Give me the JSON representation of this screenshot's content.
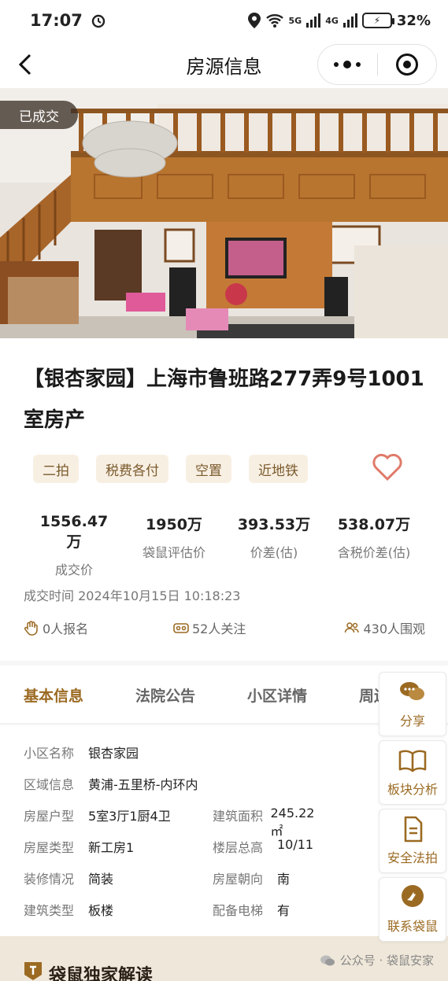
{
  "status": {
    "time": "17:07",
    "network": "5G",
    "network2": "4G",
    "battery": "32%"
  },
  "nav": {
    "title": "房源信息"
  },
  "photo": {
    "badge": "已成交"
  },
  "house": {
    "title": "【银杏家园】上海市鲁班路277弄9号1001室房产",
    "tags": [
      "二拍",
      "税费各付",
      "空置",
      "近地铁"
    ]
  },
  "stats": [
    {
      "value": "1556.47万",
      "label": "成交价"
    },
    {
      "value": "1950万",
      "label": "袋鼠评估价"
    },
    {
      "value": "393.53万",
      "label": "价差(估)"
    },
    {
      "value": "538.07万",
      "label": "含税价差(估)"
    }
  ],
  "deal": {
    "time_text": "成交时间 2024年10月15日 10:18:23"
  },
  "counts": {
    "signup": "0人报名",
    "follow": "52人关注",
    "views": "430人围观"
  },
  "tabs": [
    "基本信息",
    "法院公告",
    "小区详情",
    "周边"
  ],
  "basic": {
    "community_label": "小区名称",
    "community": "银杏家园",
    "area_label": "区域信息",
    "area": "黄浦-五里桥-内环内",
    "layout_label": "房屋户型",
    "layout": "5室3厅1厨4卫",
    "size_label": "建筑面积",
    "size": "245.22㎡",
    "type_label": "房屋类型",
    "type": "新工房1",
    "floors_label": "楼层总高",
    "floors": "10/11",
    "decor_label": "装修情况",
    "decor": "简装",
    "facing_label": "房屋朝向",
    "facing": "南",
    "build_label": "建筑类型",
    "build": "板楼",
    "elevator_label": "配备电梯",
    "elevator": "有"
  },
  "exclusive": {
    "title": "袋鼠独家解读",
    "watermark": "公众号 · 袋鼠安家"
  },
  "float": {
    "share": "分享",
    "analysis": "板块分析",
    "legal": "安全法拍",
    "contact": "联系袋鼠"
  },
  "colors": {
    "accent": "#9b6a22",
    "tag_bg": "#f8efe3",
    "heart": "#e07a6a"
  }
}
